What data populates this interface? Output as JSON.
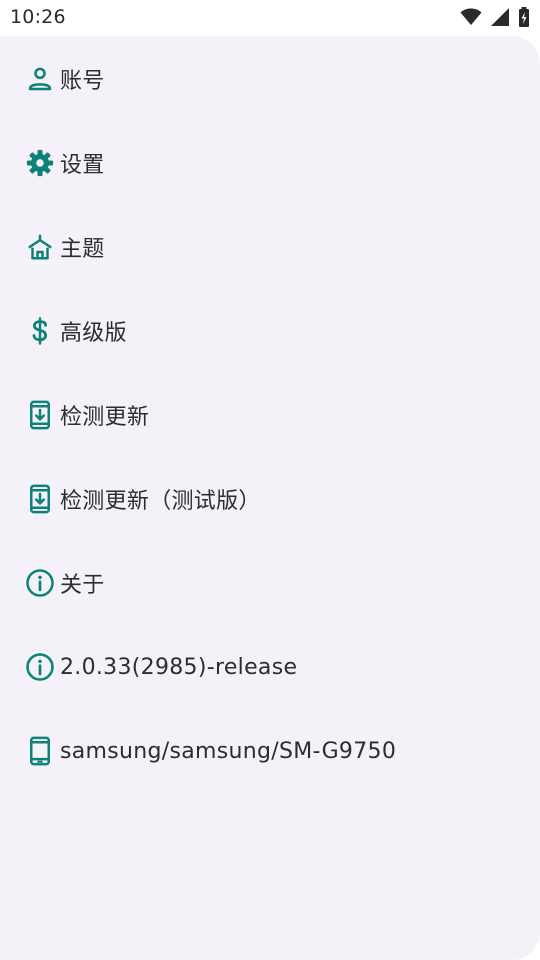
{
  "status_bar": {
    "time": "10:26",
    "icons": [
      "wifi-icon",
      "cellular-signal-icon",
      "battery-charging-icon"
    ]
  },
  "colors": {
    "accent": "#0d8277",
    "drawer_bg": "#f5f1f8",
    "text": "#2e2b33"
  },
  "menu": {
    "items": [
      {
        "id": "account",
        "label": "账号",
        "icon": "person-icon"
      },
      {
        "id": "settings",
        "label": "设置",
        "icon": "gear-icon"
      },
      {
        "id": "theme",
        "label": "主题",
        "icon": "hanger-icon"
      },
      {
        "id": "premium",
        "label": "高级版",
        "icon": "dollar-icon"
      },
      {
        "id": "check-update",
        "label": "检测更新",
        "icon": "phone-download-icon"
      },
      {
        "id": "check-update-beta",
        "label": "检测更新（测试版）",
        "icon": "phone-download-icon"
      },
      {
        "id": "about",
        "label": "关于",
        "icon": "info-icon"
      },
      {
        "id": "version",
        "label": "2.0.33(2985)-release",
        "icon": "info-icon"
      },
      {
        "id": "device",
        "label": "samsung/samsung/SM-G9750",
        "icon": "smartphone-icon"
      }
    ]
  }
}
